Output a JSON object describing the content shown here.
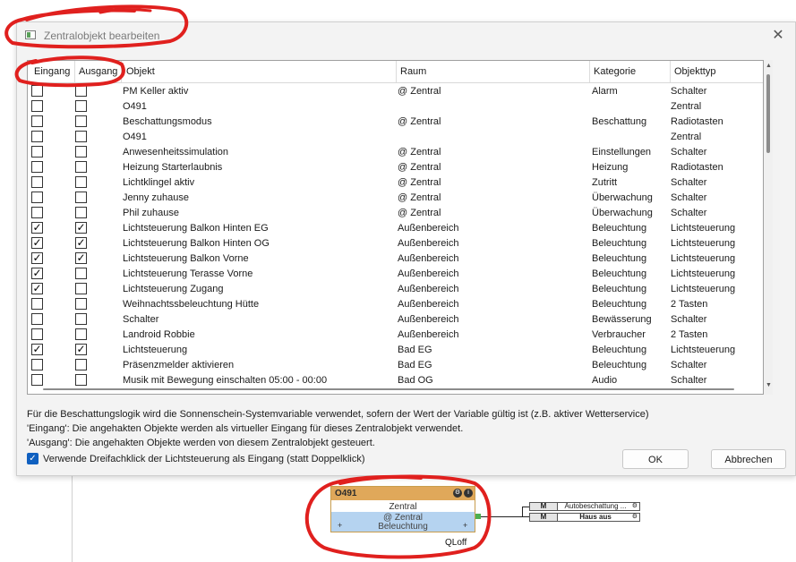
{
  "window": {
    "title": "Zentralobjekt bearbeiten",
    "close_glyph": "✕",
    "icon": "app-window-icon"
  },
  "grid": {
    "columns": [
      "Eingang",
      "Ausgang",
      "Objekt",
      "Raum",
      "Kategorie",
      "Objekttyp"
    ],
    "rows": [
      {
        "eingang": false,
        "ausgang": false,
        "objekt": "PM Keller aktiv",
        "raum": "@ Zentral",
        "kategorie": "Alarm",
        "typ": "Schalter"
      },
      {
        "eingang": false,
        "ausgang": false,
        "objekt": "O491",
        "raum": "",
        "kategorie": "",
        "typ": "Zentral"
      },
      {
        "eingang": false,
        "ausgang": false,
        "objekt": "Beschattungsmodus",
        "raum": "@ Zentral",
        "kategorie": "Beschattung",
        "typ": "Radiotasten"
      },
      {
        "eingang": false,
        "ausgang": false,
        "objekt": "O491",
        "raum": "",
        "kategorie": "",
        "typ": "Zentral"
      },
      {
        "eingang": false,
        "ausgang": false,
        "objekt": "Anwesenheitssimulation",
        "raum": "@ Zentral",
        "kategorie": "Einstellungen",
        "typ": "Schalter"
      },
      {
        "eingang": false,
        "ausgang": false,
        "objekt": "Heizung Starterlaubnis",
        "raum": "@ Zentral",
        "kategorie": "Heizung",
        "typ": "Radiotasten"
      },
      {
        "eingang": false,
        "ausgang": false,
        "objekt": "Lichtklingel aktiv",
        "raum": "@ Zentral",
        "kategorie": "Zutritt",
        "typ": "Schalter"
      },
      {
        "eingang": false,
        "ausgang": false,
        "objekt": "Jenny zuhause",
        "raum": "@ Zentral",
        "kategorie": "Überwachung",
        "typ": "Schalter"
      },
      {
        "eingang": false,
        "ausgang": false,
        "objekt": "Phil zuhause",
        "raum": "@ Zentral",
        "kategorie": "Überwachung",
        "typ": "Schalter"
      },
      {
        "eingang": true,
        "ausgang": true,
        "objekt": "Lichtsteuerung Balkon Hinten EG",
        "raum": "Außenbereich",
        "kategorie": "Beleuchtung",
        "typ": "Lichtsteuerung"
      },
      {
        "eingang": true,
        "ausgang": true,
        "objekt": "Lichtsteuerung Balkon Hinten OG",
        "raum": "Außenbereich",
        "kategorie": "Beleuchtung",
        "typ": "Lichtsteuerung"
      },
      {
        "eingang": true,
        "ausgang": true,
        "objekt": "Lichtsteuerung Balkon Vorne",
        "raum": "Außenbereich",
        "kategorie": "Beleuchtung",
        "typ": "Lichtsteuerung"
      },
      {
        "eingang": true,
        "ausgang": false,
        "objekt": "Lichtsteuerung Terasse Vorne",
        "raum": "Außenbereich",
        "kategorie": "Beleuchtung",
        "typ": "Lichtsteuerung"
      },
      {
        "eingang": true,
        "ausgang": false,
        "objekt": "Lichtsteuerung Zugang",
        "raum": "Außenbereich",
        "kategorie": "Beleuchtung",
        "typ": "Lichtsteuerung"
      },
      {
        "eingang": false,
        "ausgang": false,
        "objekt": "Weihnachtssbeleuchtung Hütte",
        "raum": "Außenbereich",
        "kategorie": "Beleuchtung",
        "typ": "2 Tasten"
      },
      {
        "eingang": false,
        "ausgang": false,
        "objekt": "Schalter",
        "raum": "Außenbereich",
        "kategorie": "Bewässerung",
        "typ": "Schalter"
      },
      {
        "eingang": false,
        "ausgang": false,
        "objekt": "Landroid Robbie",
        "raum": "Außenbereich",
        "kategorie": "Verbraucher",
        "typ": "2 Tasten"
      },
      {
        "eingang": true,
        "ausgang": true,
        "objekt": "Lichtsteuerung",
        "raum": "Bad EG",
        "kategorie": "Beleuchtung",
        "typ": "Lichtsteuerung"
      },
      {
        "eingang": false,
        "ausgang": false,
        "objekt": "Präsenzmelder aktivieren",
        "raum": "Bad EG",
        "kategorie": "Beleuchtung",
        "typ": "Schalter"
      },
      {
        "eingang": false,
        "ausgang": false,
        "objekt": "Musik mit Bewegung einschalten  05:00 - 00:00",
        "raum": "Bad OG",
        "kategorie": "Audio",
        "typ": "Schalter"
      }
    ]
  },
  "info": {
    "line1": "Für die Beschattungslogik wird die Sonnenschein-Systemvariable verwendet, sofern der Wert der Variable gültig ist (z.B. aktiver Wetterservice)",
    "line2": "'Eingang': Die angehakten Objekte werden als virtueller Eingang für dieses Zentralobjekt verwendet.",
    "line3": "'Ausgang': Die angehakten Objekte werden von diesem Zentralobjekt gesteuert."
  },
  "option": {
    "label": "Verwende Dreifachklick der Lichtsteuerung als Eingang (statt Doppelklick)",
    "checked": true
  },
  "buttons": {
    "ok": "OK",
    "cancel": "Abbrechen"
  },
  "node": {
    "title": "O491",
    "row1": "Zentral",
    "row2a": "@ Zentral",
    "row2b": "Beleuchtung",
    "output": "QLoff",
    "targets": [
      {
        "tag": "M",
        "label": "Autobeschattung ..."
      },
      {
        "tag": "M",
        "label": "Haus aus"
      }
    ]
  },
  "colors": {
    "annotation": "#e0201e",
    "node_header": "#e0a85a",
    "node_body": "#b5d3f0",
    "checkbox_accent": "#1060c0"
  }
}
